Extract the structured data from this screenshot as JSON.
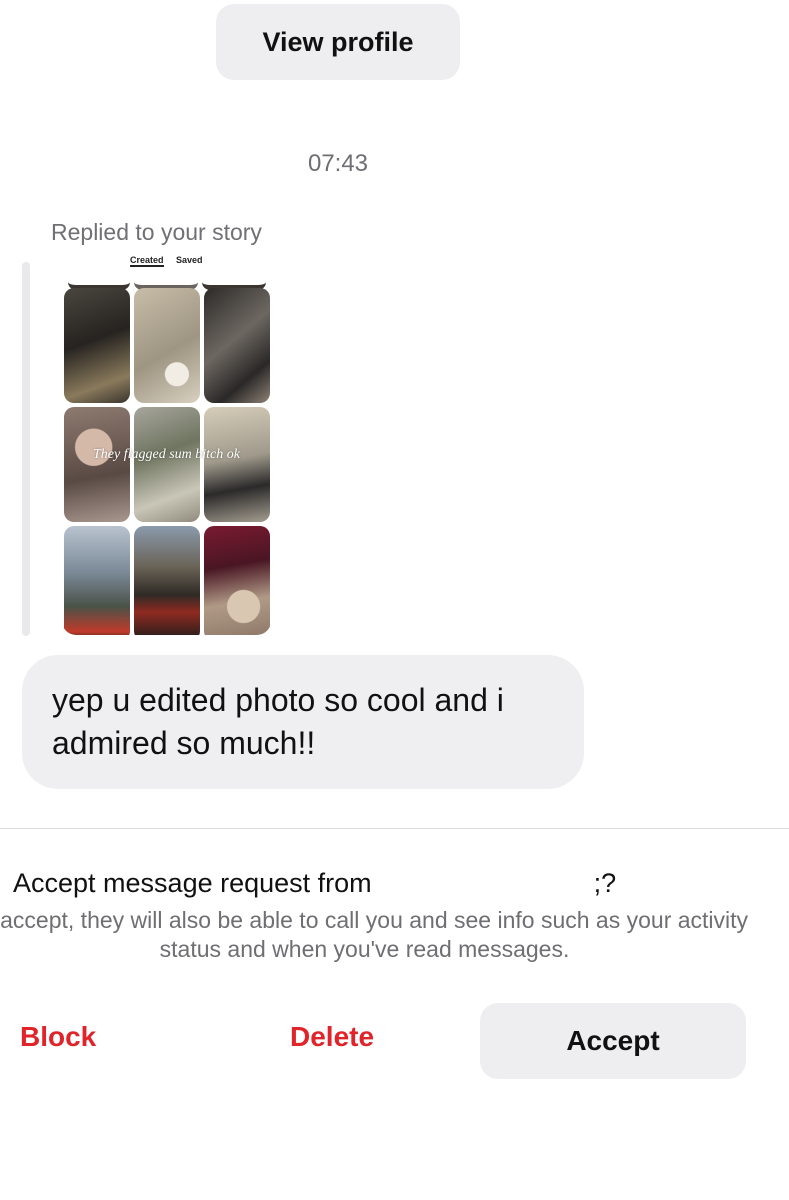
{
  "header": {
    "view_profile_label": "View profile"
  },
  "thread": {
    "timestamp": "07:43",
    "replied_label": "Replied to your story",
    "story_preview": {
      "tab_created": "Created",
      "tab_saved": "Saved",
      "overlay_text": "They flagged sum bitch ok"
    },
    "message_text": "yep u edited photo so cool and i admired so much!!"
  },
  "request": {
    "title_prefix": "Accept message request from",
    "title_suffix": ";?",
    "description": "u accept, they will also be able to call you and see info such as your activity status and when you've read messages."
  },
  "actions": {
    "block_label": "Block",
    "delete_label": "Delete",
    "accept_label": "Accept"
  },
  "colors": {
    "destructive": "#e0242a",
    "button_bg": "#eeeef1",
    "bubble_bg": "#efeff2",
    "muted_text": "#6e6e73"
  }
}
